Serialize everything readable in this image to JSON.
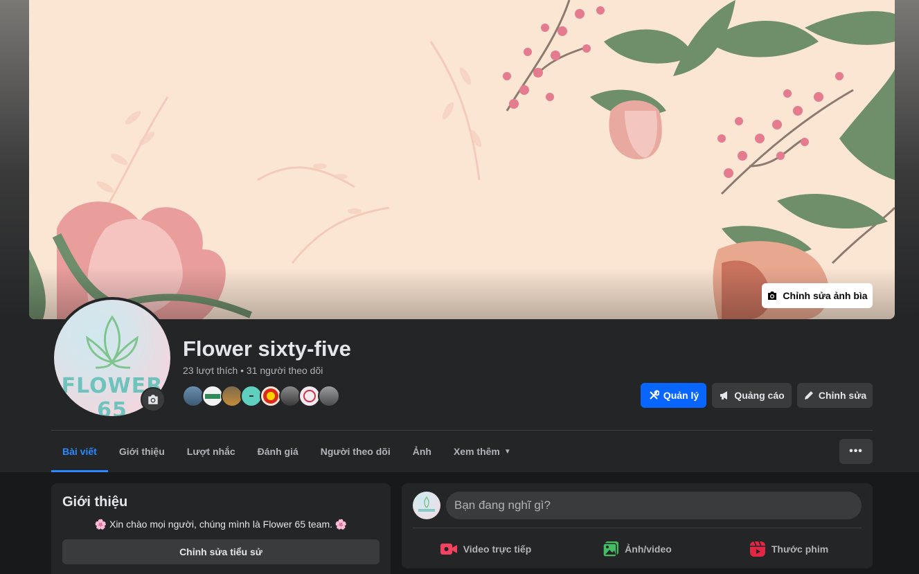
{
  "cover": {
    "edit_label": "Chỉnh sửa ảnh bìa"
  },
  "avatar": {
    "logo_text": "FLOWER 65"
  },
  "page": {
    "name": "Flower sixty-five",
    "stats": "23 lượt thích • 31 người theo dõi"
  },
  "actions": {
    "manage": "Quản lý",
    "ads": "Quảng cáo",
    "edit": "Chỉnh sửa"
  },
  "tabs": [
    {
      "label": "Bài viết"
    },
    {
      "label": "Giới thiệu"
    },
    {
      "label": "Lượt nhắc"
    },
    {
      "label": "Đánh giá"
    },
    {
      "label": "Người theo dõi"
    },
    {
      "label": "Ảnh"
    },
    {
      "label": "Xem thêm"
    }
  ],
  "more_button": "•••",
  "intro": {
    "title": "Giới thiệu",
    "bio": "🌸 Xin chào mọi người, chúng mình là Flower 65 team. 🌸",
    "edit_bio": "Chỉnh sửa tiểu sử"
  },
  "composer": {
    "placeholder": "Bạn đang nghĩ gì?",
    "live_video": "Video trực tiếp",
    "photo_video": "Ảnh/video",
    "reel": "Thước phim"
  },
  "colors": {
    "primary": "#0866ff",
    "active_tab": "#2d88ff",
    "live_icon": "#f3425f",
    "photo_icon": "#45bd62",
    "reel_icon": "#e42645"
  },
  "icons": [
    "camera-icon",
    "wrench-icon",
    "megaphone-icon",
    "pencil-icon",
    "chevron-down-icon",
    "ellipsis-icon",
    "live-video-icon",
    "photo-icon",
    "reel-icon"
  ]
}
